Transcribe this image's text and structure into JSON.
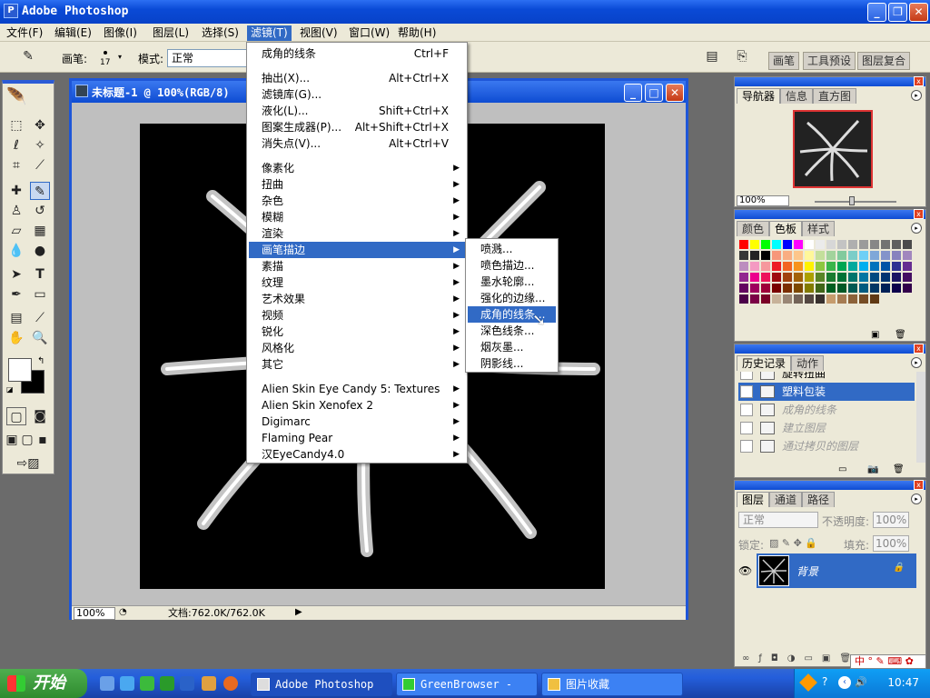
{
  "window": {
    "title": "Adobe Photoshop"
  },
  "menubar": [
    {
      "label": "文件(F)"
    },
    {
      "label": "编辑(E)"
    },
    {
      "label": "图像(I)"
    },
    {
      "label": "图层(L)"
    },
    {
      "label": "选择(S)"
    },
    {
      "label": "滤镜(T)"
    },
    {
      "label": "视图(V)"
    },
    {
      "label": "窗口(W)"
    },
    {
      "label": "帮助(H)"
    }
  ],
  "options": {
    "brush_label": "画笔:",
    "brush_size": "17",
    "mode_label": "模式:",
    "mode_value": "正常"
  },
  "palette_well": [
    "画笔",
    "工具预设",
    "图层复合"
  ],
  "document": {
    "title": "未标题-1 @ 100%(RGB/8)",
    "zoom": "100%",
    "status": "文档:762.0K/762.0K"
  },
  "filter_menu": {
    "top": [
      {
        "label": "成角的线条",
        "shortcut": "Ctrl+F"
      }
    ],
    "group1": [
      {
        "label": "抽出(X)...",
        "shortcut": "Alt+Ctrl+X"
      },
      {
        "label": "滤镜库(G)...",
        "shortcut": ""
      },
      {
        "label": "液化(L)...",
        "shortcut": "Shift+Ctrl+X"
      },
      {
        "label": "图案生成器(P)...",
        "shortcut": "Alt+Shift+Ctrl+X"
      },
      {
        "label": "消失点(V)...",
        "shortcut": "Alt+Ctrl+V"
      }
    ],
    "group2": [
      {
        "label": "像素化"
      },
      {
        "label": "扭曲"
      },
      {
        "label": "杂色"
      },
      {
        "label": "模糊"
      },
      {
        "label": "渲染"
      },
      {
        "label": "画笔描边"
      },
      {
        "label": "素描"
      },
      {
        "label": "纹理"
      },
      {
        "label": "艺术效果"
      },
      {
        "label": "视频"
      },
      {
        "label": "锐化"
      },
      {
        "label": "风格化"
      },
      {
        "label": "其它"
      }
    ],
    "group3": [
      {
        "label": "Alien Skin Eye Candy 5: Textures"
      },
      {
        "label": "Alien Skin Xenofex 2"
      },
      {
        "label": "Digimarc"
      },
      {
        "label": "Flaming Pear"
      },
      {
        "label": "汉EyeCandy4.0"
      }
    ]
  },
  "brush_strokes_submenu": [
    {
      "label": "喷溅..."
    },
    {
      "label": "喷色描边..."
    },
    {
      "label": "墨水轮廓..."
    },
    {
      "label": "强化的边缘..."
    },
    {
      "label": "成角的线条..."
    },
    {
      "label": "深色线条..."
    },
    {
      "label": "烟灰墨..."
    },
    {
      "label": "阴影线..."
    }
  ],
  "navigator": {
    "tabs": [
      "导航器",
      "信息",
      "直方图"
    ],
    "zoom": "100%"
  },
  "color_palette": {
    "tabs": [
      "颜色",
      "色板",
      "样式"
    ]
  },
  "history": {
    "tabs": [
      "历史记录",
      "动作"
    ],
    "items": [
      {
        "label": "旋转扭曲"
      },
      {
        "label": "塑料包装"
      },
      {
        "label": "成角的线条"
      },
      {
        "label": "建立图层"
      },
      {
        "label": "通过拷贝的图层"
      }
    ]
  },
  "layers": {
    "tabs": [
      "图层",
      "通道",
      "路径"
    ],
    "blend": "正常",
    "opacity_label": "不透明度:",
    "opacity": "100%",
    "lock_label": "锁定:",
    "fill_label": "填充:",
    "fill": "100%",
    "layer_name": "背景"
  },
  "taskbar": {
    "start": "开始",
    "tasks": [
      {
        "label": "Adobe Photoshop"
      },
      {
        "label": "GreenBrowser - [..."
      },
      {
        "label": "图片收藏"
      }
    ],
    "clock": "10:47"
  },
  "colors": {
    "accent": "#316ac5",
    "titlebar": "#0a4ad6",
    "menu_bg": "#ece9d8"
  }
}
